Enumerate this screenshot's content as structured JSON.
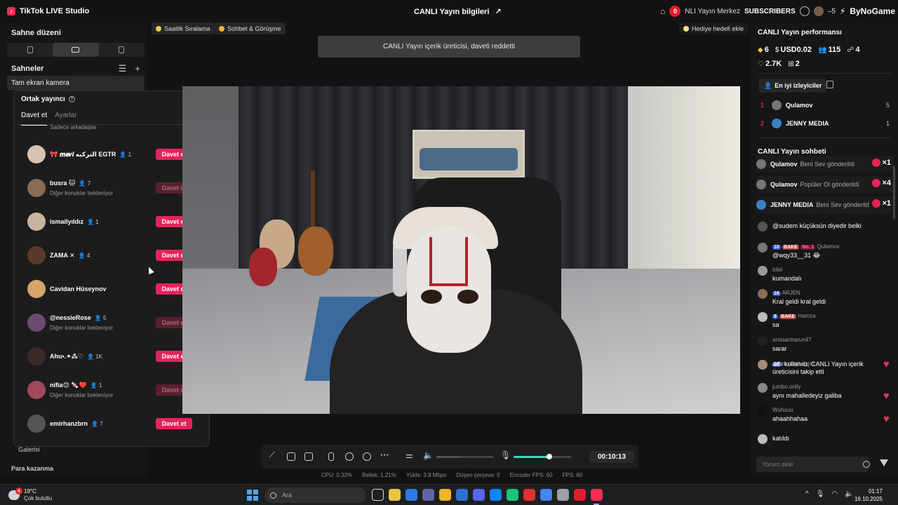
{
  "titlebar": {
    "app_name": "TikTok LIVE Studio",
    "live_info": "CANLI Yayın bilgileri",
    "notif_count": "0",
    "notif_text": "NLI Yayın Merkez",
    "subscribers": "SUBSCRIBERS",
    "count": "5",
    "brand": "ByNoGame"
  },
  "left": {
    "scene_layout_title": "Sahne düzeni",
    "scenes_title": "Sahneler",
    "scene_item": "Tam ekran kamera",
    "gift_label": "Hediye Galerisi",
    "earn_label": "Para kazanma"
  },
  "cohost": {
    "title": "Ortak yayıncı",
    "tab_invite": "Davet et",
    "tab_settings": "Ayarlar",
    "top_partial": "Sadece arkadaşlar",
    "items": [
      {
        "name": "🎀 𝒎𝒂𝒗𝒊 الترکيه EGTR",
        "count": "1",
        "sub": "",
        "button": "Davet et",
        "dim": false,
        "color": "#d8c2b0"
      },
      {
        "name": "busra 🐱",
        "count": "7",
        "sub": "Diğer konuklar bekleniyor",
        "button": "Davet et",
        "dim": true,
        "color": "#8a6b55"
      },
      {
        "name": "ismailyıldız",
        "count": "1",
        "sub": "",
        "button": "Davet et",
        "dim": false,
        "color": "#c8b4a0"
      },
      {
        "name": "ZAMA ✕",
        "count": "4",
        "sub": "",
        "button": "Davet et",
        "dim": false,
        "color": "#5a3b2b"
      },
      {
        "name": "Cavidan Hüseynov",
        "count": "",
        "sub": "",
        "button": "Davet et",
        "dim": false,
        "color": "#d4a46a"
      },
      {
        "name": "@nessieRose",
        "count": "5",
        "sub": "Diğer konuklar bekleniyor",
        "button": "Davet et",
        "dim": true,
        "color": "#6b4a70"
      },
      {
        "name": "Ahu•.✦⁂♡",
        "count": "1K",
        "sub": "",
        "button": "Davet et",
        "dim": false,
        "color": "#3a2a26"
      },
      {
        "name": "nifia😊 🍬❤️",
        "count": "1",
        "sub": "Diğer konuklar bekleniyor",
        "button": "Davet et",
        "dim": true,
        "color": "#a1485c"
      },
      {
        "name": "emirhanzbrn",
        "count": "7",
        "sub": "",
        "button": "Davet et",
        "dim": false,
        "color": "#555"
      }
    ]
  },
  "chips": {
    "hourly": "Saatlik Sıralama",
    "chat_meet": "Sohbet & Görüşme",
    "gift_goal": "Hediye hedefi ekle"
  },
  "toast": "CANLI Yayın içerik üreticisi, daveti reddetti",
  "controls": {
    "timer": "00:10:13",
    "volume_level": 0.42,
    "mic_level": 0.62
  },
  "stats": {
    "cpu": "CPU: 0.32%",
    "memory": "Bellek: 1.21%",
    "load": "Yükle: 3.8 Mbps",
    "dropped": "Düşen çerçeve: 0",
    "encoder": "Encoder FPS: 60",
    "fps": "FPS: 60"
  },
  "performance": {
    "title": "CANLI Yayın performansı",
    "diamonds": "6",
    "usd": "USD0.02",
    "viewers": "115",
    "followers": "4",
    "likes": "2.7K",
    "gifts": "2"
  },
  "top_viewers": {
    "tab": "En iyi izleyiciler",
    "rows": [
      {
        "rank": "1",
        "name": "Qulamov",
        "score": "5",
        "color": "#777"
      },
      {
        "rank": "2",
        "name": "JENNY MEDIA",
        "score": "1",
        "color": "#3b82c4"
      }
    ]
  },
  "chat": {
    "title": "CANLI Yayın sohbeti",
    "gifts": [
      {
        "name": "Qulamov",
        "text": "Beni Sev gönderildi",
        "times": "×1",
        "color": "#777"
      },
      {
        "name": "Qulamov",
        "text": "Popüler Ol gönderildi",
        "times": "×4",
        "color": "#777"
      },
      {
        "name": "JENNY MEDIA",
        "text": "Beni Sev gönderildi",
        "times": "×1",
        "color": "#3b82c4"
      }
    ],
    "messages": [
      {
        "user": "",
        "text": "@sudem küçüksün diyedir belki",
        "color": "#555",
        "heart": false
      },
      {
        "user": "Qulamov",
        "badges": "10|BAKE|No. 1",
        "text": "@wqy33__31 😂",
        "color": "#777",
        "heart": false
      },
      {
        "user": "bilal",
        "text": "kumandalı",
        "color": "#9a9a9a",
        "heart": false
      },
      {
        "user": "ARJEN",
        "badges": "16",
        "text": "Kral geldi kral geldi",
        "color": "#8a6b55",
        "heart": false
      },
      {
        "user": "Hamza",
        "badges": "8|BAKE",
        "text": "sa",
        "color": "#bbb",
        "heart": false
      },
      {
        "user": "arslaanharun47",
        "text": "sarar",
        "color": "#222",
        "heart": false
      },
      {
        "user": "m.izzet.dgnn",
        "badges": "16",
        "text": "adlı kullanıcı, CANLI Yayın içerik üreticisini takip etti",
        "color": "#a58b7a",
        "heart": true
      },
      {
        "user": "jumbo.onlly",
        "text": "aynı mahalledeyiz galiba",
        "color": "#888",
        "heart": true
      },
      {
        "user": "Wuhuuu",
        "text": "ahaahhahaa",
        "color": "#111",
        "heart": true
      },
      {
        "user": "",
        "text": "katıldı",
        "color": "#bbb",
        "heart": false
      }
    ],
    "placeholder": "Yorum ekle"
  },
  "taskbar": {
    "weather_badge": "4",
    "temp": "19°C",
    "weather": "Çok bulutlu",
    "search": "Ara",
    "time": "01:17",
    "date": "16.10.2025",
    "apps": [
      "#f5f5f5",
      "#e8c547",
      "#2b7be4",
      "#6264a7",
      "#f0b429",
      "#2f6fd1",
      "#5865f2",
      "#0a84ff",
      "#19c37d",
      "#e03131",
      "#4285f4",
      "#9aa0a6",
      "#e11d2f",
      "#fe2c55"
    ]
  },
  "colors": {
    "accent": "#e3245b",
    "mic_green": "#2fdcb8"
  }
}
